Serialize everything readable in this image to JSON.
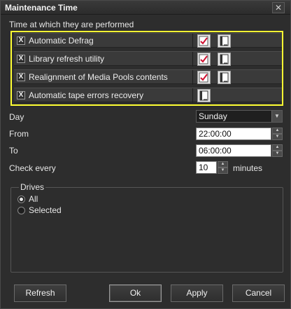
{
  "window": {
    "title": "Maintenance Time",
    "close_glyph": "✕"
  },
  "section_label": "Time at which they are performed",
  "tasks": [
    {
      "label": "Automatic Defrag",
      "checked": true,
      "icons": [
        "calendar-check-icon",
        "book-icon"
      ]
    },
    {
      "label": "Library refresh utility",
      "checked": true,
      "icons": [
        "calendar-check-icon",
        "book-icon"
      ]
    },
    {
      "label": "Realignment of Media Pools contents",
      "checked": true,
      "icons": [
        "calendar-check-icon",
        "book-icon"
      ]
    },
    {
      "label": "Automatic tape errors recovery",
      "checked": true,
      "icons": [
        "book-icon"
      ]
    }
  ],
  "checkbox_glyph": "X",
  "day": {
    "label": "Day",
    "value": "Sunday"
  },
  "from": {
    "label": "From",
    "value": "22:00:00"
  },
  "to": {
    "label": "To",
    "value": "06:00:00"
  },
  "check_every": {
    "label": "Check every",
    "value": "10",
    "unit": "minutes"
  },
  "drives": {
    "legend": "Drives",
    "options": [
      {
        "label": "All",
        "selected": true
      },
      {
        "label": "Selected",
        "selected": false
      }
    ]
  },
  "buttons": {
    "refresh": "Refresh",
    "ok": "Ok",
    "apply": "Apply",
    "cancel": "Cancel"
  },
  "colors": {
    "highlight_border": "#ffff33",
    "background": "#2d2d2d"
  }
}
